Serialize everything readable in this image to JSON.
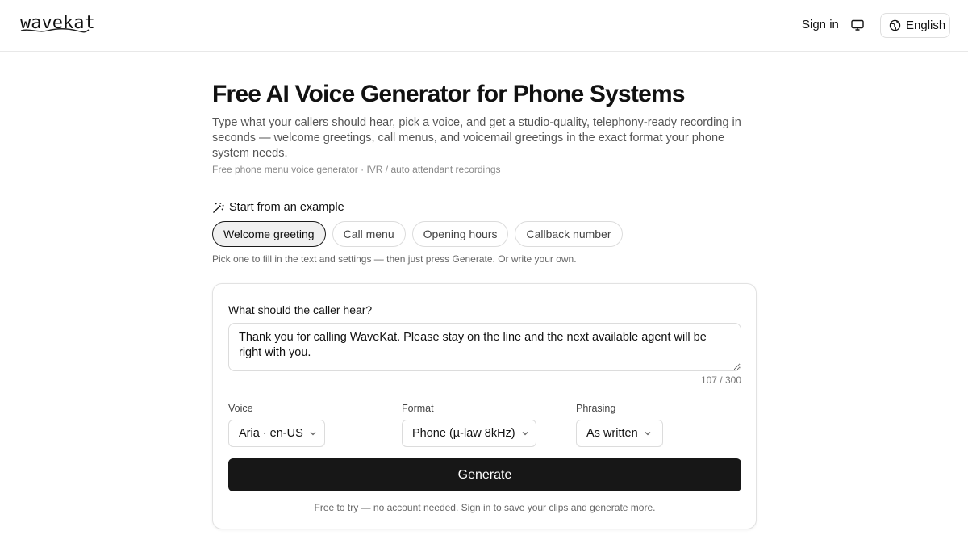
{
  "header": {
    "logo": "wavekat",
    "sign_in": "Sign in",
    "display_icon": "monitor-icon",
    "language_icon": "globe-icon",
    "language": "English"
  },
  "hero": {
    "title": "Free AI Voice Generator for Phone Systems",
    "subtitle": "Type what your callers should hear, pick a voice, and get a studio-quality, telephony-ready recording in seconds — welcome greetings, call menus, and voicemail greetings in the exact format your phone system needs.",
    "tagline": "Free phone menu voice generator · IVR / auto attendant recordings"
  },
  "examples": {
    "icon": "magic-wand-icon",
    "heading": "Start from an example",
    "chips": [
      {
        "label": "Welcome greeting",
        "active": true
      },
      {
        "label": "Call menu",
        "active": false
      },
      {
        "label": "Opening hours",
        "active": false
      },
      {
        "label": "Callback number",
        "active": false
      }
    ],
    "help": "Pick one to fill in the text and settings — then just press Generate. Or write your own."
  },
  "form": {
    "text_label": "What should the caller hear?",
    "text_value": "Thank you for calling WaveKat. Please stay on the line and the next available agent will be right with you.",
    "counter": "107 / 300",
    "voice_label": "Voice",
    "voice_value": "Aria · en-US",
    "format_label": "Format",
    "format_value": "Phone (µ-law 8kHz)",
    "phrasing_label": "Phrasing",
    "phrasing_value": "As written",
    "chevron_icon": "chevron-down-icon",
    "generate_label": "Generate",
    "footnote": "Free to try — no account needed. Sign in to save your clips and generate more."
  },
  "colors": {
    "primary_button": "#171717",
    "border": "#dcdcdc",
    "muted_text": "#555555"
  }
}
